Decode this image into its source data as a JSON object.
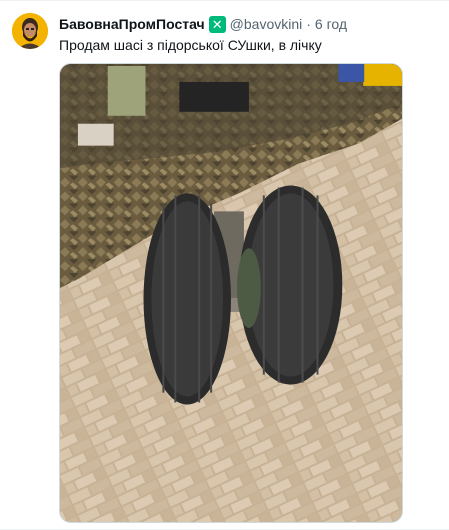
{
  "post": {
    "author": {
      "display_name": "БавовнаПромПостач",
      "badge_glyph": "✕",
      "handle": "@bavovkini",
      "separator": "·",
      "time": "6 год"
    },
    "text": "Продам шасі з підорської СУшки, в лічку",
    "media": {
      "icon": "photo"
    }
  },
  "colors": {
    "badge": "#00ba7c",
    "secondary_text": "#536471",
    "primary_text": "#0f1419"
  }
}
